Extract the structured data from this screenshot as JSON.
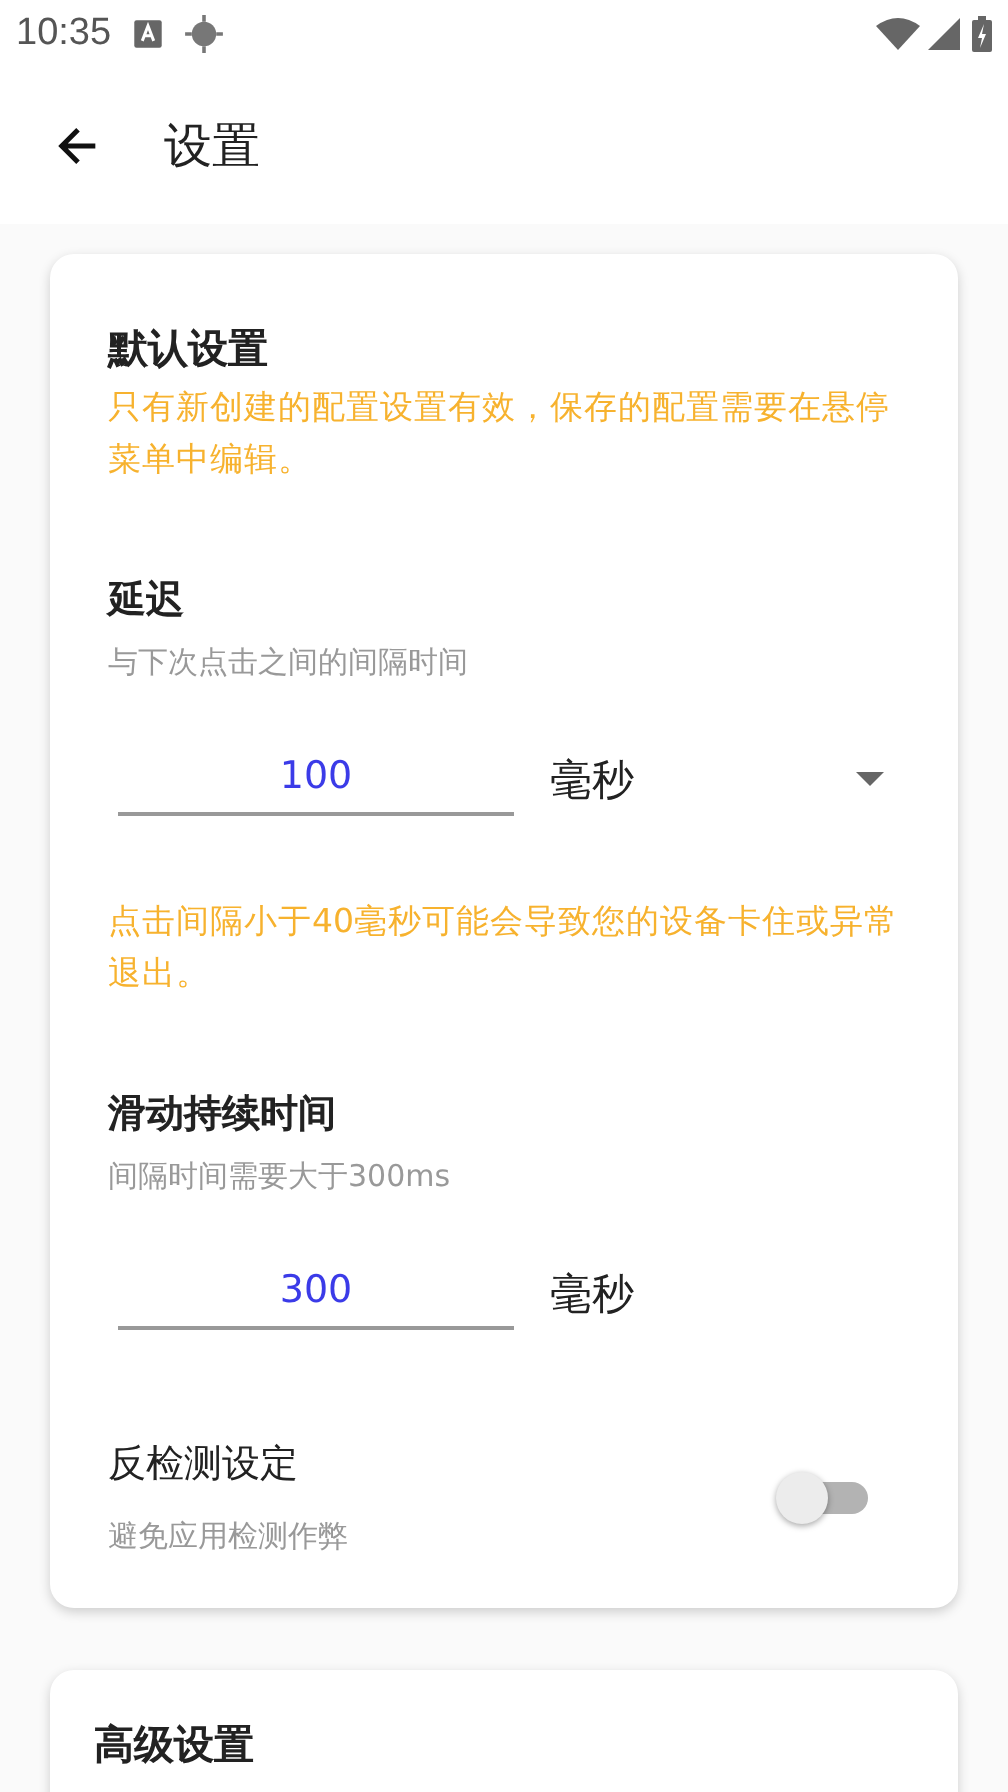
{
  "status_bar": {
    "time": "10:35"
  },
  "app_bar": {
    "title": "设置"
  },
  "cards": [
    {
      "title": "默认设置",
      "sections": [
        {
          "kind": "note",
          "text": "只有新创建的配置设置有效，保存的配置需要在悬停菜单中编辑。"
        },
        {
          "kind": "number",
          "title": "延迟",
          "subtitle": "与下次点击之间的间隔时间",
          "value": "100",
          "unit": {
            "kind": "dropdown",
            "label": "毫秒"
          }
        },
        {
          "kind": "note",
          "text": "点击间隔小于40毫秒可能会导致您的设备卡住或异常退出。"
        },
        {
          "kind": "number",
          "title": "滑动持续时间",
          "subtitle": "间隔时间需要大于300ms",
          "value": "300",
          "unit": {
            "kind": "text",
            "label": "毫秒"
          }
        },
        {
          "kind": "switch",
          "title": "反检测设定",
          "subtitle": "避免应用检测作弊",
          "on": false
        }
      ]
    },
    {
      "title": "高级设置"
    }
  ]
}
